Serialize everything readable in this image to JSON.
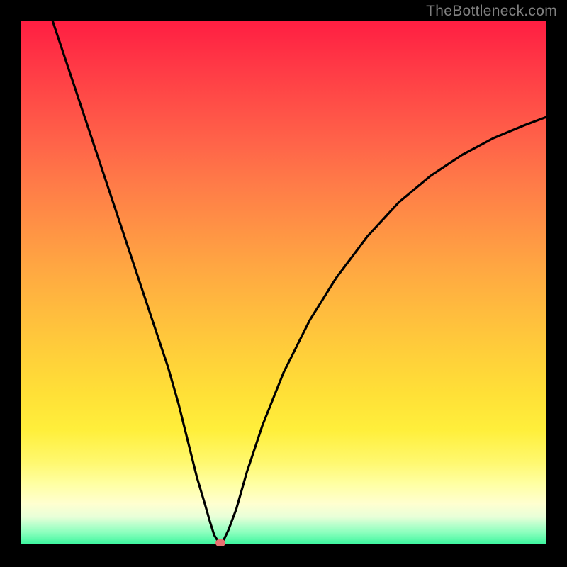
{
  "watermark": "TheBottleneck.com",
  "chart_data": {
    "type": "line",
    "title": "",
    "xlabel": "",
    "ylabel": "",
    "xlim": [
      0,
      100
    ],
    "ylim": [
      0,
      100
    ],
    "grid": false,
    "curve": {
      "x": [
        6,
        8,
        10,
        12,
        14,
        16,
        18,
        20,
        22,
        24,
        26,
        28,
        30,
        32,
        33.5,
        35,
        36,
        36.8,
        37.5,
        38,
        38.5,
        39.5,
        41,
        43,
        46,
        50,
        55,
        60,
        66,
        72,
        78,
        84,
        90,
        96,
        100
      ],
      "y": [
        100,
        94,
        88,
        82,
        76,
        70,
        64,
        58,
        52,
        46,
        40,
        34,
        27,
        19,
        13,
        8,
        4.5,
        2,
        0.9,
        0.6,
        0.9,
        3,
        7,
        14,
        23,
        33,
        43,
        51,
        59,
        65.5,
        70.5,
        74.5,
        77.7,
        80.2,
        81.7
      ]
    },
    "marker": {
      "x": 38,
      "y": 0.6,
      "color": "#e97171"
    },
    "background_gradient": {
      "type": "vertical",
      "stops": [
        {
          "pos": 0.0,
          "color": "#ff1e42"
        },
        {
          "pos": 0.5,
          "color": "#ffb040"
        },
        {
          "pos": 0.8,
          "color": "#fff23e"
        },
        {
          "pos": 0.92,
          "color": "#ffffd0"
        },
        {
          "pos": 1.0,
          "color": "#31f59c"
        }
      ]
    }
  }
}
